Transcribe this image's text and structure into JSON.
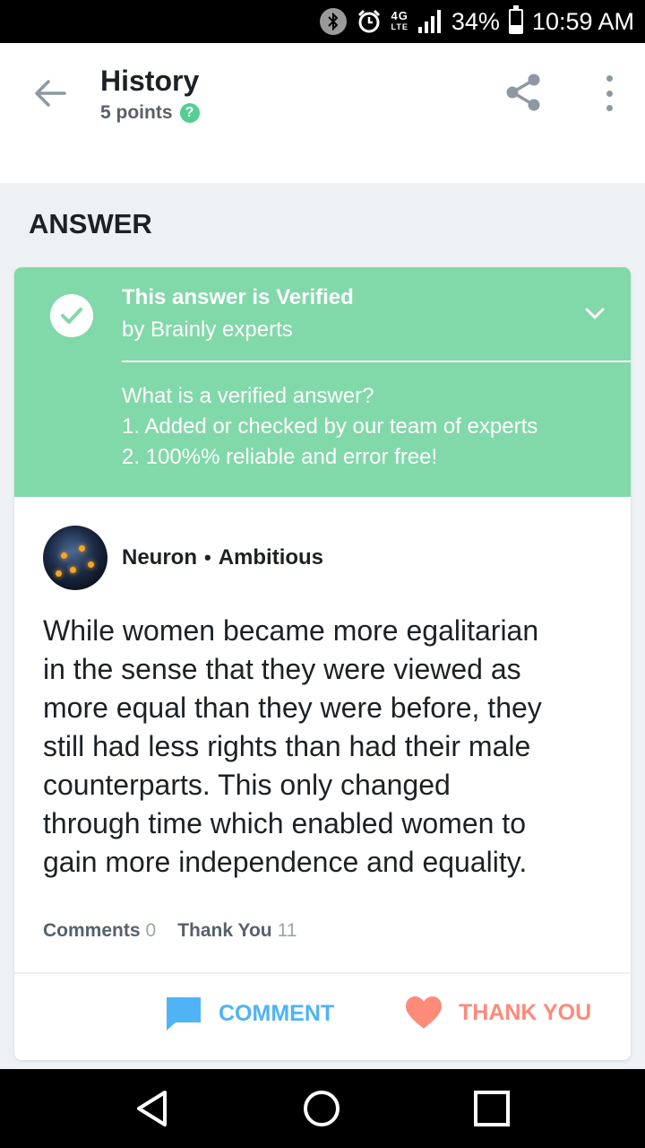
{
  "status_bar": {
    "network": "4G",
    "lte": "LTE",
    "battery": "34%",
    "battery_level": 0.34,
    "time": "10:59 AM",
    "icons": [
      "bluetooth-icon",
      "alarm-icon",
      "signal-icon",
      "battery-icon"
    ]
  },
  "header": {
    "title": "History",
    "points": "5 points",
    "help_glyph": "?"
  },
  "answer_section": {
    "heading": "ANSWER"
  },
  "verified": {
    "title": "This answer is Verified",
    "subtitle": "by Brainly experts",
    "info": [
      "What is a verified answer?",
      "1. Added or checked by our team of experts",
      "2. 100%% reliable and error free!"
    ]
  },
  "author": {
    "name": "Neuron",
    "separator": "•",
    "rank": "Ambitious"
  },
  "answer": {
    "lines": [
      "While women became more egalitarian",
      "in the sense that they were viewed as",
      "more equal than they were before, they",
      "still had less rights than had their male",
      "counterparts. This only changed",
      "through time which enabled women to",
      "gain more independence and equality."
    ]
  },
  "stats": {
    "comments_label": "Comments",
    "comments_count": "0",
    "thanks_label": "Thank You",
    "thanks_count": "11"
  },
  "actions": {
    "comment": "COMMENT",
    "thank_you": "THANK YOU"
  },
  "colors": {
    "verified_green": "#81d8a9",
    "comment_blue": "#4fb3f6",
    "thanks_coral": "#fe8a7a",
    "help_green": "#53cf92"
  }
}
